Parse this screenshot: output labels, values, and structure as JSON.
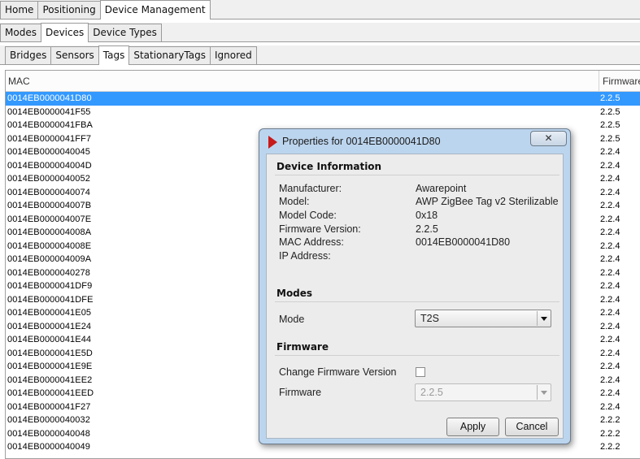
{
  "top_tabs": [
    "Home",
    "Positioning",
    "Device Management"
  ],
  "mid_tabs": [
    "Modes",
    "Devices",
    "Device Types"
  ],
  "sub_tabs": [
    "Bridges",
    "Sensors",
    "Tags",
    "StationaryTags",
    "Ignored"
  ],
  "grid": {
    "col_mac": "MAC",
    "col_firmware": "Firmware",
    "rows": [
      {
        "mac": "0014EB0000041D80",
        "fw": "2.2.5",
        "selected": true
      },
      {
        "mac": "0014EB0000041F55",
        "fw": "2.2.5"
      },
      {
        "mac": "0014EB0000041FBA",
        "fw": "2.2.5"
      },
      {
        "mac": "0014EB0000041FF7",
        "fw": "2.2.5"
      },
      {
        "mac": "0014EB0000040045",
        "fw": "2.2.4"
      },
      {
        "mac": "0014EB000004004D",
        "fw": "2.2.4"
      },
      {
        "mac": "0014EB0000040052",
        "fw": "2.2.4"
      },
      {
        "mac": "0014EB0000040074",
        "fw": "2.2.4"
      },
      {
        "mac": "0014EB000004007B",
        "fw": "2.2.4"
      },
      {
        "mac": "0014EB000004007E",
        "fw": "2.2.4"
      },
      {
        "mac": "0014EB000004008A",
        "fw": "2.2.4"
      },
      {
        "mac": "0014EB000004008E",
        "fw": "2.2.4"
      },
      {
        "mac": "0014EB000004009A",
        "fw": "2.2.4"
      },
      {
        "mac": "0014EB0000040278",
        "fw": "2.2.4"
      },
      {
        "mac": "0014EB0000041DF9",
        "fw": "2.2.4"
      },
      {
        "mac": "0014EB0000041DFE",
        "fw": "2.2.4"
      },
      {
        "mac": "0014EB0000041E05",
        "fw": "2.2.4"
      },
      {
        "mac": "0014EB0000041E24",
        "fw": "2.2.4"
      },
      {
        "mac": "0014EB0000041E44",
        "fw": "2.2.4"
      },
      {
        "mac": "0014EB0000041E5D",
        "fw": "2.2.4"
      },
      {
        "mac": "0014EB0000041E9E",
        "fw": "2.2.4"
      },
      {
        "mac": "0014EB0000041EE2",
        "fw": "2.2.4"
      },
      {
        "mac": "0014EB0000041EED",
        "fw": "2.2.4"
      },
      {
        "mac": "0014EB0000041F27",
        "fw": "2.2.4"
      },
      {
        "mac": "0014EB0000040032",
        "fw": "2.2.2"
      },
      {
        "mac": "0014EB0000040048",
        "fw": "2.2.2"
      },
      {
        "mac": "0014EB0000040049",
        "fw": "2.2.2"
      }
    ]
  },
  "dialog": {
    "title": "Properties for 0014EB0000041D80",
    "close_glyph": "✕",
    "device_info": {
      "heading": "Device Information",
      "manufacturer_label": "Manufacturer:",
      "manufacturer": "Awarepoint",
      "model_label": "Model:",
      "model": "AWP ZigBee Tag v2 Sterilizable",
      "model_code_label": "Model Code:",
      "model_code": "0x18",
      "firmware_version_label": "Firmware Version:",
      "firmware_version": "2.2.5",
      "mac_label": "MAC Address:",
      "mac": "0014EB0000041D80",
      "ip_label": "IP Address:",
      "ip": ""
    },
    "modes": {
      "heading": "Modes",
      "mode_label": "Mode",
      "mode_value": "T2S"
    },
    "firmware": {
      "heading": "Firmware",
      "change_label": "Change Firmware Version",
      "change_checked": false,
      "firmware_label": "Firmware",
      "firmware_value": "2.2.5"
    },
    "apply_label": "Apply",
    "cancel_label": "Cancel"
  },
  "colors": {
    "selection": "#3399ff",
    "dialog_frame": "#bcd5ee",
    "logo": "#c81a1a"
  }
}
